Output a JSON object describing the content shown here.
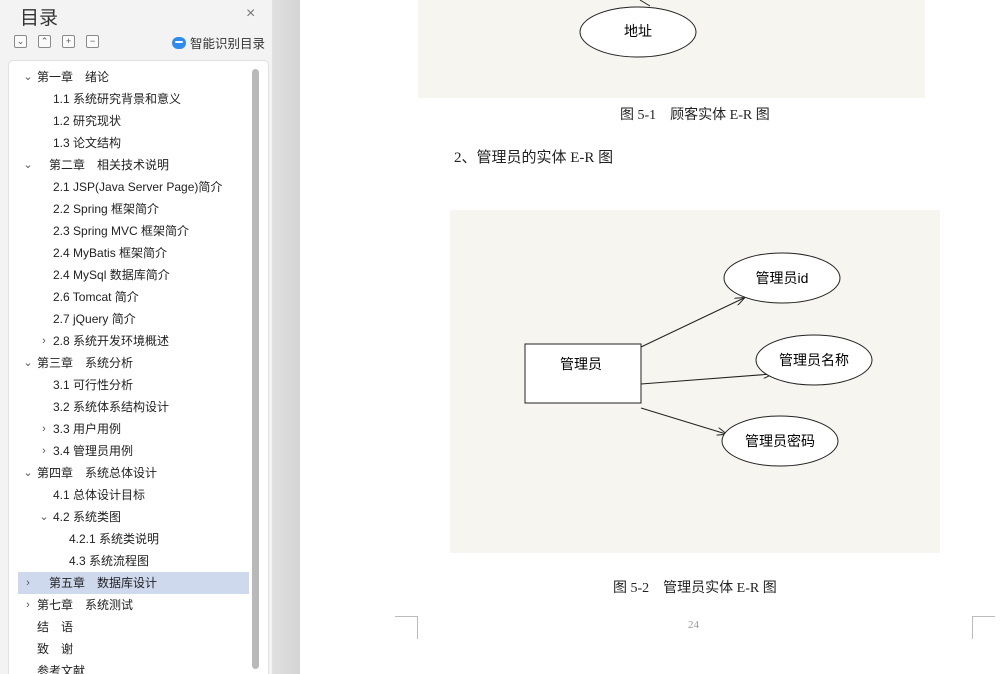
{
  "outline": {
    "title": "目录",
    "close_icon": "×",
    "toolbar": {
      "collapse_all": "⌄",
      "expand_up": "⌃",
      "add": "+",
      "remove": "−"
    },
    "ai_toc_label": "智能识别目录",
    "items": [
      {
        "label": "第一章　绪论",
        "level": 0,
        "caret": "⌄"
      },
      {
        "label": "1.1 系统研究背景和意义",
        "level": 1,
        "caret": ""
      },
      {
        "label": "1.2 研究现状",
        "level": 1,
        "caret": ""
      },
      {
        "label": "1.3 论文结构",
        "level": 1,
        "caret": ""
      },
      {
        "label": "第二章　相关技术说明",
        "level": 0,
        "caret": "⌄",
        "indent_extra": true
      },
      {
        "label": "2.1 JSP(Java Server Page)简介",
        "level": 1,
        "caret": ""
      },
      {
        "label": "2.2 Spring 框架简介",
        "level": 1,
        "caret": ""
      },
      {
        "label": "2.3 Spring MVC 框架简介",
        "level": 1,
        "caret": ""
      },
      {
        "label": "2.4 MyBatis  框架简介",
        "level": 1,
        "caret": ""
      },
      {
        "label": "2.4 MySql 数据库简介",
        "level": 1,
        "caret": ""
      },
      {
        "label": "2.6 Tomcat 简介",
        "level": 1,
        "caret": ""
      },
      {
        "label": "2.7 jQuery 简介",
        "level": 1,
        "caret": ""
      },
      {
        "label": "2.8 系统开发环境概述",
        "level": 1,
        "caret": "›"
      },
      {
        "label": "第三章　系统分析",
        "level": 0,
        "caret": "⌄"
      },
      {
        "label": "3.1 可行性分析",
        "level": 1,
        "caret": ""
      },
      {
        "label": "3.2 系统体系结构设计",
        "level": 1,
        "caret": ""
      },
      {
        "label": "3.3 用户用例",
        "level": 1,
        "caret": "›"
      },
      {
        "label": "3.4 管理员用例",
        "level": 1,
        "caret": "›"
      },
      {
        "label": "第四章　系统总体设计",
        "level": 0,
        "caret": "⌄"
      },
      {
        "label": "4.1 总体设计目标",
        "level": 1,
        "caret": ""
      },
      {
        "label": "4.2 系统类图",
        "level": 1,
        "caret": "⌄"
      },
      {
        "label": "4.2.1 系统类说明",
        "level": 2,
        "caret": ""
      },
      {
        "label": "4.3 系统流程图",
        "level": 2,
        "caret": ""
      },
      {
        "label": "第五章　数据库设计",
        "level": 0,
        "caret": "›",
        "indent_extra": true,
        "selected": true
      },
      {
        "label": "第七章　系统测试",
        "level": 0,
        "caret": "›"
      },
      {
        "label": "结　语",
        "level": 0,
        "caret": ""
      },
      {
        "label": "致　谢",
        "level": 0,
        "caret": ""
      },
      {
        "label": "参考文献",
        "level": 0,
        "caret": ""
      }
    ]
  },
  "document": {
    "fig1_entity_attr": "地址",
    "fig1_caption": "图 5-1　顾客实体 E-R 图",
    "section_heading": "2、管理员的实体 E-R 图",
    "fig2": {
      "entity": "管理员",
      "attributes": [
        "管理员id",
        "管理员名称",
        "管理员密码"
      ]
    },
    "fig2_caption": "图 5-2　管理员实体 E-R 图",
    "page_number": "24"
  },
  "colors": {
    "selection": "#cfd9ee",
    "figure_background": "#f7f5ef",
    "ai_icon": "#2e8bf0"
  }
}
